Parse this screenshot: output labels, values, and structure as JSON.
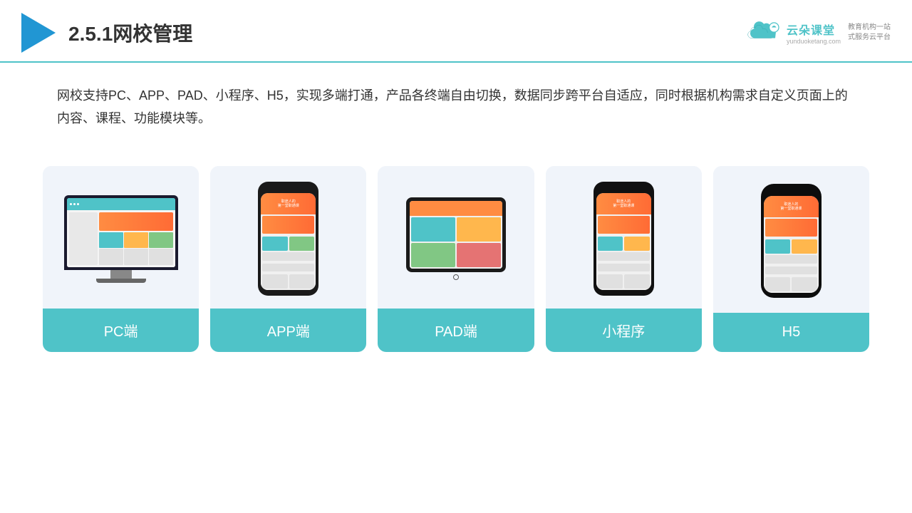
{
  "header": {
    "title": "2.5.1网校管理",
    "brand": {
      "name": "云朵课堂",
      "url": "yunduoketang.com",
      "tagline": "教育机构一站\n式服务云平台"
    }
  },
  "description": "网校支持PC、APP、PAD、小程序、H5，实现多端打通，产品各终端自由切换，数据同步跨平台自适应，同时根据机构需求自定义页面上的内容、课程、功能模块等。",
  "cards": [
    {
      "id": "pc",
      "label": "PC端"
    },
    {
      "id": "app",
      "label": "APP端"
    },
    {
      "id": "pad",
      "label": "PAD端"
    },
    {
      "id": "mini",
      "label": "小程序"
    },
    {
      "id": "h5",
      "label": "H5"
    }
  ],
  "colors": {
    "accent": "#4FC3C8",
    "headerBorder": "#4FC3C8",
    "cardBg": "#f0f4fa",
    "labelBg": "#4FC3C8"
  }
}
